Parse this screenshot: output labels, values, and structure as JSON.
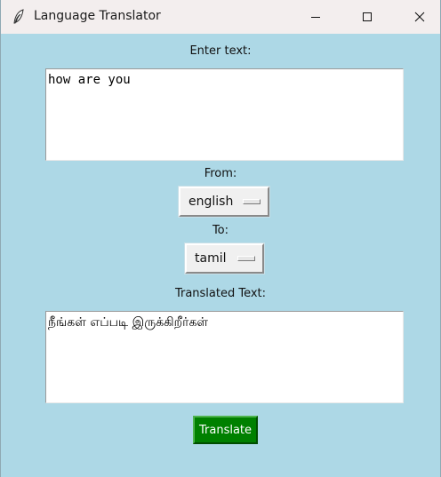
{
  "window": {
    "title": "Language Translator",
    "icon": "feather-icon"
  },
  "controls": {
    "minimize_icon": "minimize-icon",
    "maximize_icon": "maximize-icon",
    "close_icon": "close-icon"
  },
  "form": {
    "enter_text_label": "Enter text:",
    "input_value": "how are you",
    "from_label": "From:",
    "from_value": "english",
    "to_label": "To:",
    "to_value": "tamil",
    "translated_label": "Translated Text:",
    "output_value": "நீங்கள் எப்படி இருக்கிறீர்கள்",
    "translate_button": "Translate"
  },
  "colors": {
    "background": "#add8e6",
    "button": "#008000",
    "button_text": "#ffffff"
  }
}
